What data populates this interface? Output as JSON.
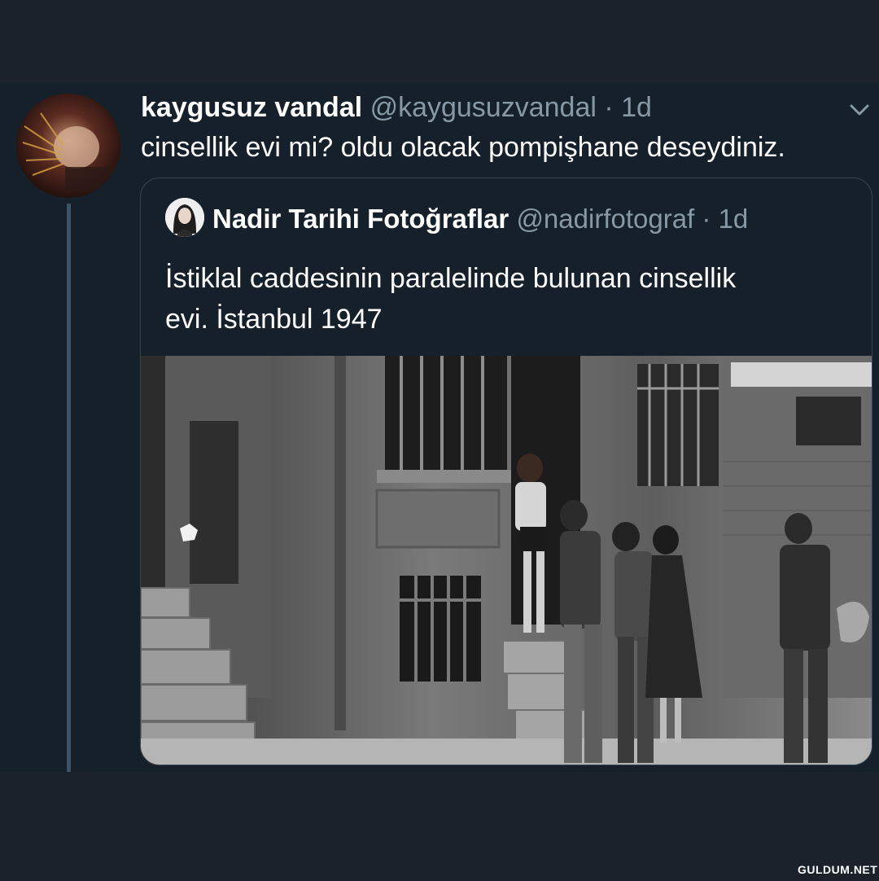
{
  "tweet": {
    "author_name": "kaygusuz vandal",
    "author_handle": "@kaygusuzvandal",
    "separator": "·",
    "time": "1d",
    "text": "cinsellik evi mi? oldu olacak pompişhane deseydiniz.",
    "menu_icon": "chevron-down-icon"
  },
  "quoted_tweet": {
    "author_name": "Nadir Tarihi Fotoğraflar",
    "author_handle": "@nadirfotograf",
    "separator": "·",
    "time": "1d",
    "text_line1": "İstiklal caddesinin paralelinde bulunan cinsellik",
    "text_line2": "evi.  İstanbul 1947"
  },
  "watermark": "GULDUM.NET",
  "colors": {
    "background": "#15202b",
    "outer_band": "#1b222c",
    "text_primary": "#ffffff",
    "text_secondary": "#8899a6",
    "border": "#38444d",
    "thread_line": "#3d5466"
  }
}
